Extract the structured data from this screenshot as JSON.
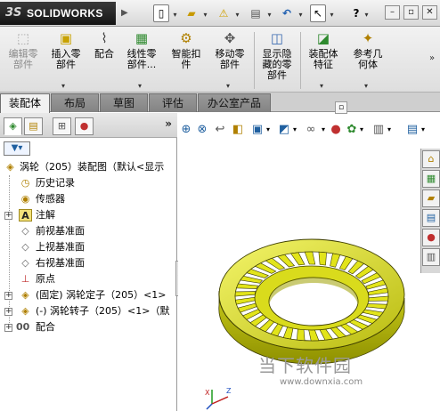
{
  "app": {
    "brand_prefix": "3S",
    "brand_name": "SOLIDWORKS"
  },
  "quick_access": [
    {
      "icon": "new-document-icon",
      "glyph": "▢"
    },
    {
      "icon": "open-folder-icon",
      "glyph": "📂"
    },
    {
      "icon": "rebuild-icon",
      "glyph": "⚠"
    },
    {
      "icon": "print-icon",
      "glyph": "🖶"
    },
    {
      "icon": "undo-icon",
      "glyph": "↶"
    },
    {
      "icon": "select-pointer-icon",
      "glyph": "↖"
    },
    {
      "icon": "help-icon",
      "glyph": "?"
    }
  ],
  "ribbon": {
    "items": [
      {
        "label": "编辑零\n部件",
        "icon": "edit-component-icon",
        "glyph": "⬚",
        "disabled": true
      },
      {
        "label": "插入零\n部件",
        "icon": "insert-component-icon",
        "glyph": "▣",
        "disabled": false
      },
      {
        "label": "配合",
        "icon": "mate-icon",
        "glyph": "📎",
        "disabled": false
      },
      {
        "label": "线性零\n部件...",
        "icon": "linear-pattern-icon",
        "glyph": "▦",
        "disabled": false
      },
      {
        "label": "智能扣\n件",
        "icon": "smart-fastener-icon",
        "glyph": "⚙",
        "disabled": false
      },
      {
        "label": "移动零\n部件",
        "icon": "move-component-icon",
        "glyph": "✥",
        "disabled": false
      },
      {
        "label": "显示隐\n藏的零\n部件",
        "icon": "show-hidden-icon",
        "glyph": "◫",
        "disabled": false
      },
      {
        "label": "装配体\n特征",
        "icon": "assembly-feature-icon",
        "glyph": "◪",
        "disabled": false
      },
      {
        "label": "参考几\n何体",
        "icon": "reference-geometry-icon",
        "glyph": "✦",
        "disabled": false
      }
    ]
  },
  "tabs": [
    {
      "label": "装配体",
      "active": true
    },
    {
      "label": "布局",
      "active": false
    },
    {
      "label": "草图",
      "active": false
    },
    {
      "label": "评估",
      "active": false
    },
    {
      "label": "办公室产品",
      "active": false
    }
  ],
  "feature_manager": {
    "panel_tabs": [
      "feature-manager-icon",
      "property-manager-icon",
      "configuration-manager-icon",
      "display-manager-icon"
    ],
    "more": "»",
    "tree": [
      {
        "text": "涡轮（205）装配图（默认<显示",
        "icon": "assembly-icon",
        "indent": 0,
        "expander": ""
      },
      {
        "text": "历史记录",
        "icon": "history-icon",
        "indent": 1,
        "expander": ""
      },
      {
        "text": "传感器",
        "icon": "sensor-icon",
        "indent": 1,
        "expander": ""
      },
      {
        "text": "注解",
        "icon": "annotation-icon",
        "indent": 1,
        "expander": "+"
      },
      {
        "text": "前视基准面",
        "icon": "plane-icon",
        "indent": 1,
        "expander": ""
      },
      {
        "text": "上视基准面",
        "icon": "plane-icon",
        "indent": 1,
        "expander": ""
      },
      {
        "text": "右视基准面",
        "icon": "plane-icon",
        "indent": 1,
        "expander": ""
      },
      {
        "text": "原点",
        "icon": "origin-icon",
        "indent": 1,
        "expander": ""
      },
      {
        "text": "(固定) 涡轮定子（205）<1>",
        "icon": "part-icon",
        "indent": 1,
        "expander": "+"
      },
      {
        "text": "(-) 涡轮转子（205）<1>（默",
        "icon": "part-icon",
        "indent": 1,
        "expander": "+"
      },
      {
        "text": "配合",
        "icon": "mates-folder-icon",
        "indent": 1,
        "expander": "+"
      }
    ]
  },
  "watermark": {
    "text": "当下软件园",
    "url": "www.downxia.com"
  },
  "colors": {
    "part_yellow": "#e6e800",
    "part_dark": "#7a7a00",
    "ribbon_bg": "#e6e6e6",
    "tab_inactive": "#8f8f8f"
  }
}
